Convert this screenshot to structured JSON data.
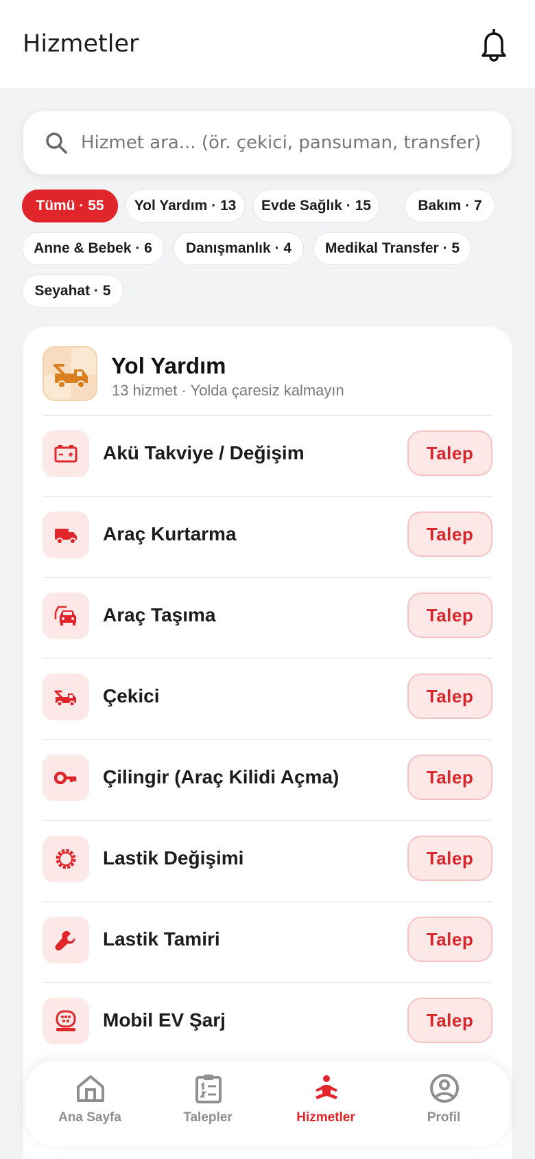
{
  "header": {
    "title": "Hizmetler",
    "bell_icon": "bell-icon"
  },
  "search": {
    "placeholder": "Hizmet ara... (ör. çekici, pansuman, transfer)",
    "value": ""
  },
  "chips": [
    {
      "label": "Tümü · 55",
      "active": true
    },
    {
      "label": "Yol Yardım · 13",
      "active": false
    },
    {
      "label": "Evde Sağlık · 15",
      "active": false
    },
    {
      "label": "Bakım · 7",
      "active": false
    },
    {
      "label": "Anne & Bebek · 6",
      "active": false
    },
    {
      "label": "Danışmanlık · 4",
      "active": false
    },
    {
      "label": "Medikal Transfer · 5",
      "active": false
    },
    {
      "label": "Seyahat · 5",
      "active": false
    }
  ],
  "category": {
    "title": "Yol Yardım",
    "subtitle": "13 hizmet · Yolda çaresiz kalmayın",
    "icon": "tow-truck-icon",
    "items": [
      {
        "label": "Akü Takviye / Değişim",
        "icon": "battery-icon",
        "action": "Talep"
      },
      {
        "label": "Araç Kurtarma",
        "icon": "truck-icon",
        "action": "Talep"
      },
      {
        "label": "Araç Taşıma",
        "icon": "car-transport-icon",
        "action": "Talep"
      },
      {
        "label": "Çekici",
        "icon": "tow-truck-icon",
        "action": "Talep"
      },
      {
        "label": "Çilingir (Araç Kilidi Açma)",
        "icon": "key-icon",
        "action": "Talep"
      },
      {
        "label": "Lastik Değişimi",
        "icon": "tire-icon",
        "action": "Talep"
      },
      {
        "label": "Lastik Tamiri",
        "icon": "wrench-icon",
        "action": "Talep"
      },
      {
        "label": "Mobil EV Şarj",
        "icon": "ev-charger-icon",
        "action": "Talep"
      }
    ]
  },
  "tabbar": [
    {
      "label": "Ana Sayfa",
      "icon": "home-icon",
      "active": false
    },
    {
      "label": "Talepler",
      "icon": "clipboard-icon",
      "active": false
    },
    {
      "label": "Hizmetler",
      "icon": "services-icon",
      "active": true
    },
    {
      "label": "Profil",
      "icon": "profile-icon",
      "active": false
    }
  ],
  "colors": {
    "accent": "#e0262b",
    "accent_soft": "#fde8e8",
    "category_bg": "#fbe8d2",
    "category_icon": "#e0852b"
  }
}
